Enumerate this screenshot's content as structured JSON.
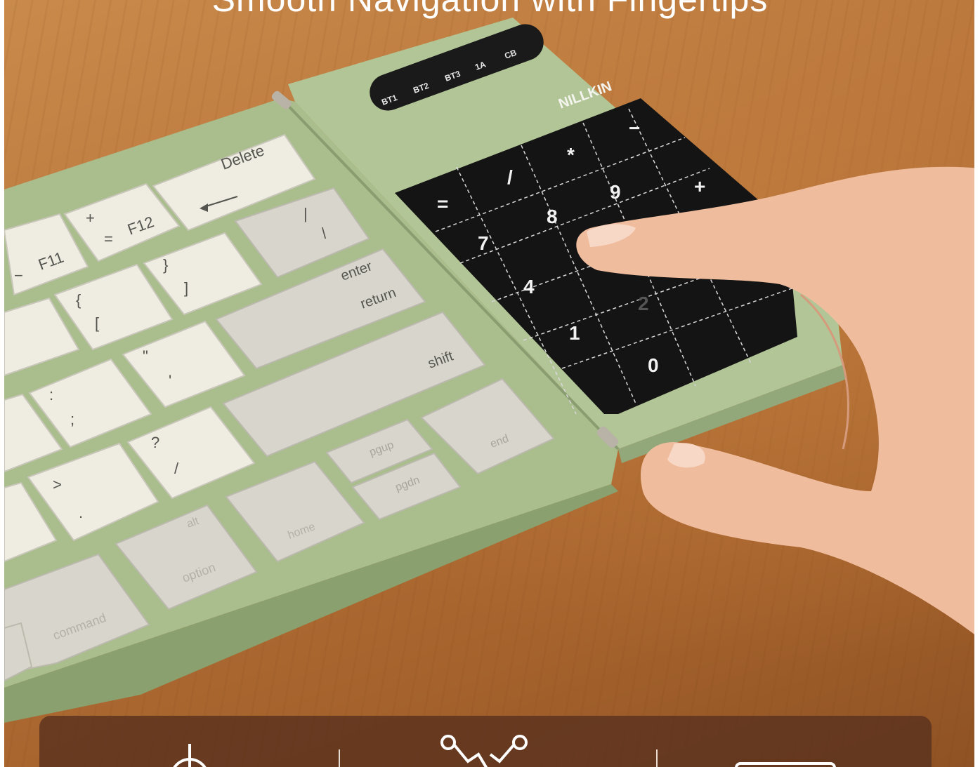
{
  "headline": "Smooth Navigation with Fingertips",
  "brand": "NILLKIN",
  "indicator_labels": [
    "BT1",
    "BT2",
    "BT3",
    "1A",
    "CB"
  ],
  "numpad_keys": [
    "=",
    "/",
    "*",
    "−",
    "9",
    "+",
    "8",
    "7",
    "4",
    "1",
    "0",
    "2"
  ],
  "keys": {
    "delete": "Delete",
    "f11": "F11",
    "f12": "F12",
    "plus": "+",
    "equals": "=",
    "minus": "−",
    "brace_open": "{",
    "bracket_open": "[",
    "brace_close": "}",
    "bracket_close": "]",
    "pipe": "|",
    "backslash": "\\",
    "enter": "enter",
    "return": "return",
    "quote": "\"",
    "apostrophe": "'",
    "colon": ":",
    "semicolon": ";",
    "shift": "shift",
    "question": "?",
    "slash": "/",
    "greater": ">",
    "period": ".",
    "pgup": "pgup",
    "pgdn": "pgdn",
    "end": "end",
    "home": "home",
    "alt": "alt",
    "option": "option",
    "command": "command"
  },
  "colors": {
    "keyboard_body": "#a9bd8d",
    "numpad": "#141414",
    "key_light": "#efece2",
    "key_gray": "#d8d6cc",
    "wood": "#b8743a",
    "feature_bar": "#5a321e"
  },
  "feature_icons": [
    "power-icon",
    "network-icon",
    "battery-icon"
  ]
}
